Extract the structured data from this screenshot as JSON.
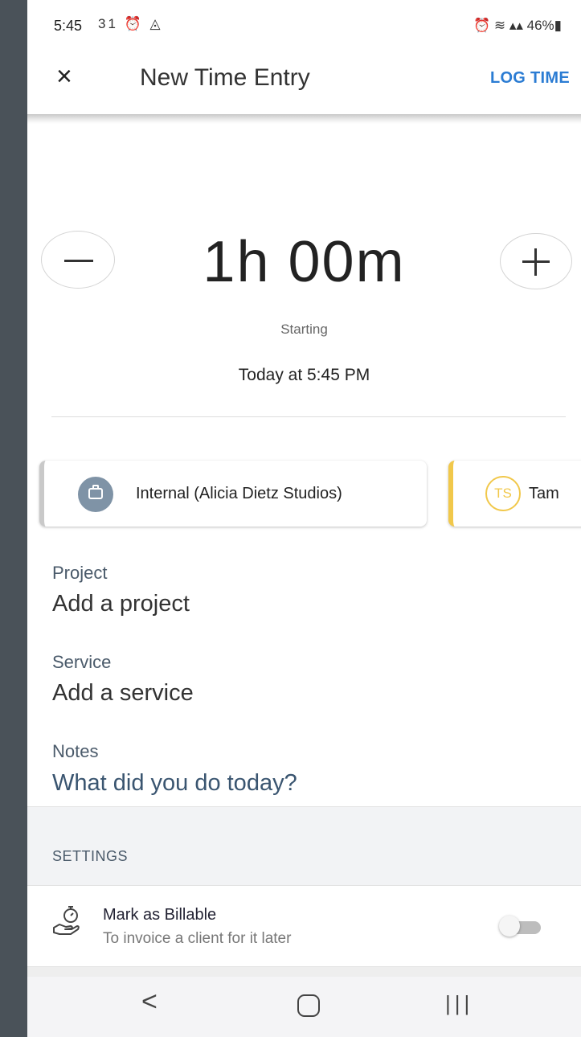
{
  "status_bar": {
    "time": "5:45",
    "left_icons": "31 ⏰ ◬",
    "right_text": "⏰ ≋ ▴▴ 46%▮"
  },
  "app_bar": {
    "close_icon": "×",
    "title": "New Time Entry",
    "action_label": "LOG TIME",
    "action_color": "#2b7cd3"
  },
  "timer": {
    "duration": "1h 00m",
    "starting_label": "Starting",
    "start_time": "Today at 5:45 PM"
  },
  "clients": [
    {
      "label": "Internal (Alicia Dietz Studios)",
      "icon": "briefcase-icon",
      "accent": "#c9c9c9"
    },
    {
      "label": "Tam",
      "initials": "TS",
      "accent": "#f1c84b"
    }
  ],
  "fields": {
    "project": {
      "label": "Project",
      "value": "Add a project"
    },
    "service": {
      "label": "Service",
      "value": "Add a service"
    },
    "notes": {
      "label": "Notes",
      "placeholder": "What did you do today?"
    }
  },
  "settings": {
    "title": "SETTINGS",
    "billable": {
      "title": "Mark as Billable",
      "subtitle": "To invoice a client for it later",
      "enabled": false,
      "icon": "stopwatch-hand-icon"
    }
  },
  "nav_bar": {
    "back": "<",
    "recents": "|||"
  }
}
